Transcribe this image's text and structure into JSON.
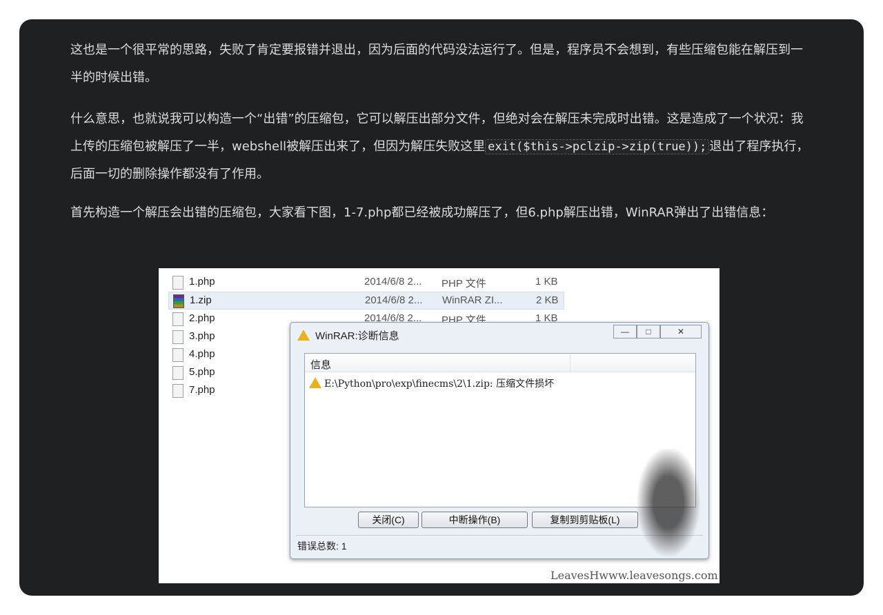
{
  "article": {
    "p1": "这也是一个很平常的思路，失败了肯定要报错并退出，因为后面的代码没法运行了。但是，程序员不会想到，有些压缩包能在解压到一半的时候出错。",
    "p2_pre": "什么意思，也就说我可以构造一个“出错”的压缩包，它可以解压出部分文件，但绝对会在解压未完成时出错。这是造成了一个状况：我上传的压缩包被解压了一半，webshell被解压出来了，但因为解压失败这里",
    "p2_code": "exit($this->pclzip->zip(true));",
    "p2_post": "退出了程序执行，后面一切的删除操作都没有了作用。",
    "p3": "首先构造一个解压会出错的压缩包，大家看下图，1-7.php都已经被成功解压了，但6.php解压出错，WinRAR弹出了出错信息："
  },
  "screenshot": {
    "files": [
      {
        "name": "1.php",
        "date": "2014/6/8 2...",
        "type": "PHP 文件",
        "size": "1 KB",
        "icon": "php-file-icon"
      },
      {
        "name": "1.zip",
        "date": "2014/6/8 2...",
        "type": "WinRAR ZI...",
        "size": "2 KB",
        "icon": "winrar-archive-icon"
      },
      {
        "name": "2.php",
        "date": "2014/6/8 2...",
        "type": "PHP 文件",
        "size": "1 KB",
        "icon": "php-file-icon"
      },
      {
        "name": "3.php",
        "icon": "php-file-icon"
      },
      {
        "name": "4.php",
        "icon": "php-file-icon"
      },
      {
        "name": "5.php",
        "icon": "php-file-icon"
      },
      {
        "name": "7.php",
        "icon": "php-file-icon"
      }
    ],
    "dialog": {
      "title": "WinRAR:诊断信息",
      "column_header": "信息",
      "message": "E:\\Python\\pro\\exp\\finecms\\2\\1.zip: 压缩文件损坏",
      "btn_close": "关闭(C)",
      "btn_abort": "中断操作(B)",
      "btn_copy": "复制到剪贴板(L)",
      "status": "错误总数: 1"
    },
    "watermark": "LeavesHwww.leavesongs.com"
  },
  "colors": {
    "card_bg": "#1f2022",
    "text": "#dcdcdc",
    "warning": "#e8b21c"
  }
}
